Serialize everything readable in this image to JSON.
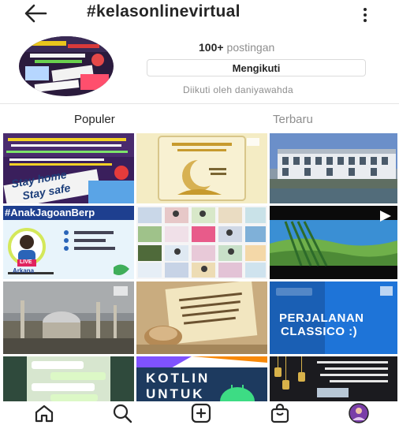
{
  "header": {
    "title": "#kelasonlinevirtual",
    "back_icon": "arrow-left-icon",
    "more_icon": "more-vertical-icon"
  },
  "hashtag": {
    "post_count": "100+",
    "post_label": "postingan",
    "follow_button": "Mengikuti",
    "followed_by": "Diikuti oleh daniyawahda"
  },
  "tabs": [
    {
      "label": "Populer",
      "active": true
    },
    {
      "label": "Terbaru",
      "active": false
    }
  ],
  "grid": {
    "tiles": [
      {
        "name": "post-stay-home",
        "texts": [
          "Stay home",
          "Stay safe"
        ]
      },
      {
        "name": "post-ramadan-card",
        "texts": []
      },
      {
        "name": "post-school-building",
        "texts": []
      },
      {
        "name": "post-anak-jagoan",
        "texts": [
          "#AnakJagoanBerp",
          "LIVE",
          "Arkana"
        ]
      },
      {
        "name": "post-collage",
        "texts": []
      },
      {
        "name": "post-landscape-video",
        "texts": []
      },
      {
        "name": "post-mosque",
        "texts": []
      },
      {
        "name": "post-arabic-note",
        "texts": []
      },
      {
        "name": "post-perjalanan",
        "texts": [
          "PERJALANAN",
          "CLASSICO :)"
        ]
      },
      {
        "name": "post-chat-screenshot",
        "texts": []
      },
      {
        "name": "post-kotlin",
        "texts": [
          "KOTLIN",
          "UNTUK"
        ]
      },
      {
        "name": "post-ramadan-lanterns",
        "texts": []
      }
    ]
  },
  "bottom_nav": [
    {
      "name": "home-icon"
    },
    {
      "name": "search-icon"
    },
    {
      "name": "add-post-icon"
    },
    {
      "name": "shop-icon"
    },
    {
      "name": "profile-avatar"
    }
  ],
  "colors": {
    "text": "#262626",
    "secondary_text": "#8e8e8e",
    "border": "#dbdbdb"
  }
}
